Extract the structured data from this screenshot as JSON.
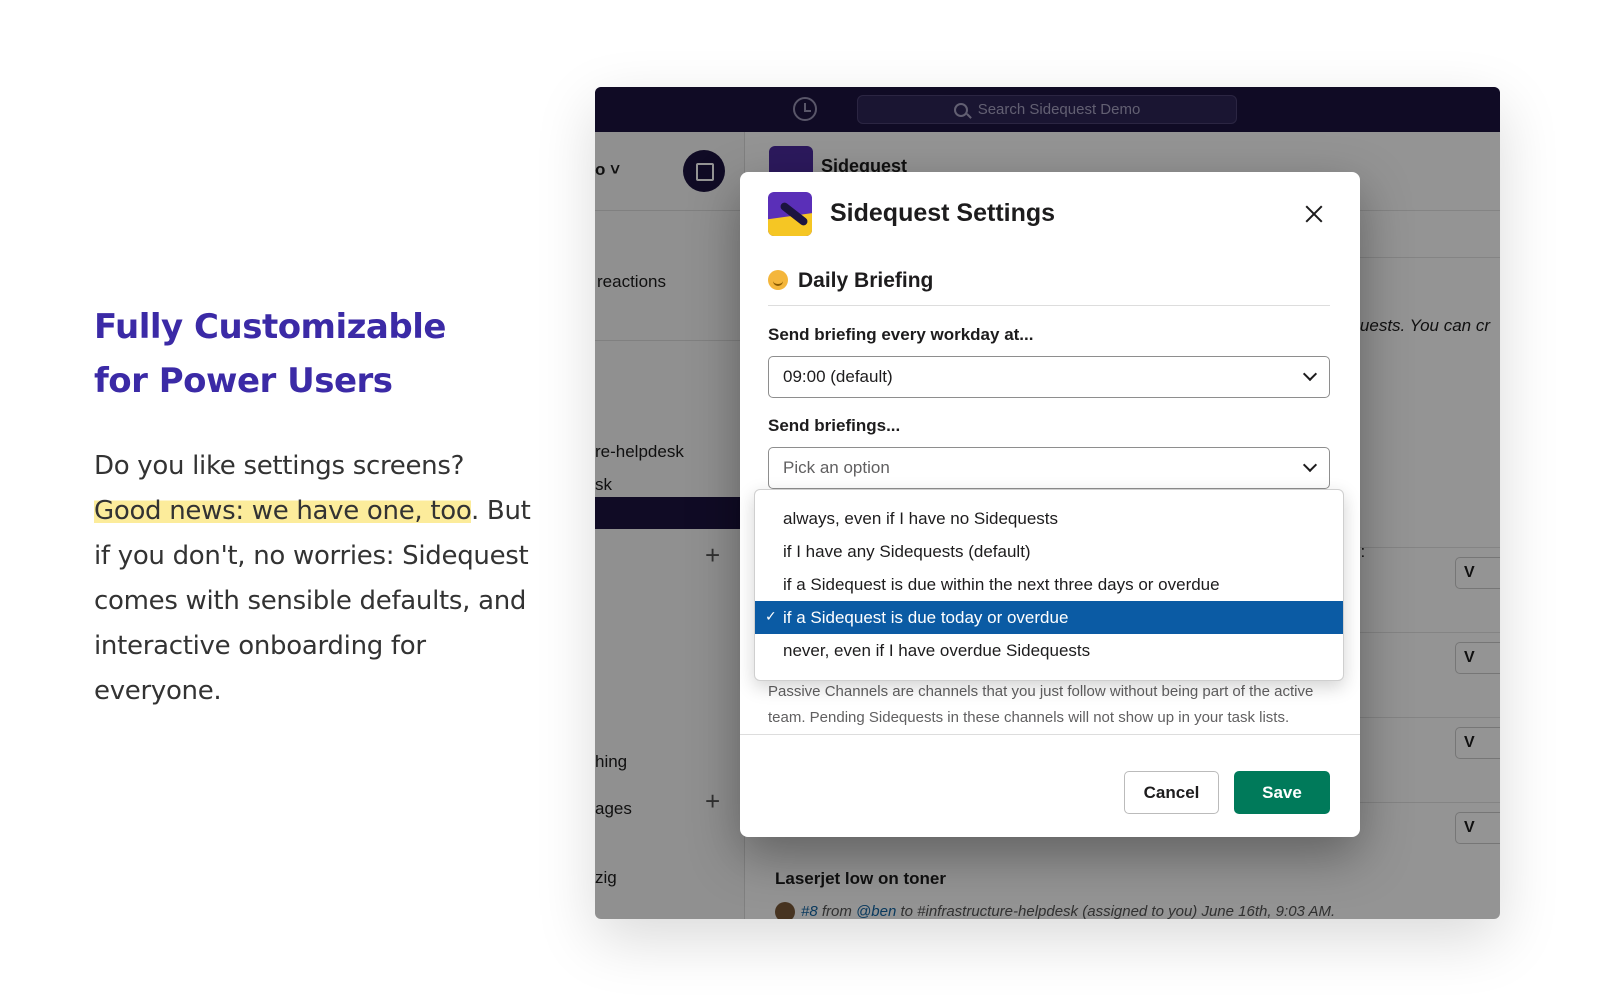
{
  "marketing": {
    "heading_line1": "Fully Customizable",
    "heading_line2": "for Power Users",
    "body_part1": "Do you like settings screens?",
    "body_highlight": "Good news: we have one, too",
    "body_part2": ". But if you don't, no worries: Sidequest comes with sensible defaults, and interactive onboarding for everyone."
  },
  "app": {
    "search_placeholder": "Search Sidequest Demo",
    "workspace_fragment": "o ˅",
    "sidebar_items": [
      "reactions",
      "re-helpdesk",
      "sk",
      "hing",
      "ages",
      "zig"
    ],
    "main": {
      "app_title": "Sidequest",
      "italic_fragment": "equests. You can cr",
      "colon_fragment": "o:",
      "view_button_label": "V",
      "message_title": "Laserjet low on toner",
      "message_ticket": "#8",
      "message_from": "from",
      "message_user": "@ben",
      "message_rest": "to #infrastructure-helpdesk (assigned to you) June 16th, 9:03 AM."
    }
  },
  "modal": {
    "title": "Sidequest Settings",
    "section_title": "Daily Briefing",
    "field1_label": "Send briefing every workday at...",
    "field1_value": "09:00 (default)",
    "field2_label": "Send briefings...",
    "field2_placeholder": "Pick an option",
    "options": [
      "always, even if I have no Sidequests",
      "if I have any Sidequests (default)",
      "if a Sidequest is due within the next three days or overdue",
      "if a Sidequest is due today or overdue",
      "never, even if I have overdue Sidequests"
    ],
    "selected_index": 3,
    "check_mark": "✓",
    "help_text": "Passive Channels are channels that you just follow without being part of the active team. Pending Sidequests in these channels will not show up in your task lists.",
    "cancel_label": "Cancel",
    "save_label": "Save"
  },
  "colors": {
    "heading": "#3b2aa6",
    "highlight": "#fcec9b",
    "topbar": "#1c1440",
    "selected_option": "#0b5ba4",
    "save_button": "#007a5a"
  }
}
